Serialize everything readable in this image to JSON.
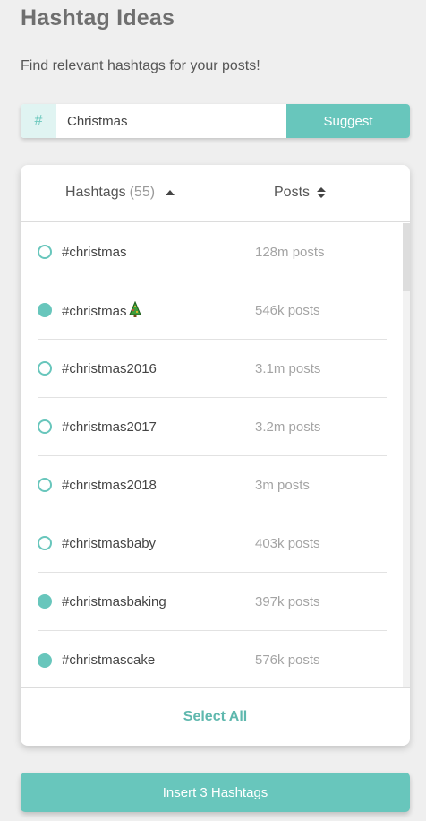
{
  "header": {
    "title": "Hashtag Ideas",
    "subtitle": "Find relevant hashtags for your posts!"
  },
  "search": {
    "prefix": "#",
    "value": "Christmas",
    "suggest_label": "Suggest"
  },
  "table": {
    "col_hashtags_label": "Hashtags",
    "col_hashtags_count": "(55)",
    "col_posts_label": "Posts",
    "rows": [
      {
        "tag": "#christmas",
        "posts": "128m posts",
        "selected": false,
        "emoji": ""
      },
      {
        "tag": "#christmas",
        "posts": "546k posts",
        "selected": true,
        "emoji": "tree-icon"
      },
      {
        "tag": "#christmas2016",
        "posts": "3.1m posts",
        "selected": false,
        "emoji": ""
      },
      {
        "tag": "#christmas2017",
        "posts": "3.2m posts",
        "selected": false,
        "emoji": ""
      },
      {
        "tag": "#christmas2018",
        "posts": "3m posts",
        "selected": false,
        "emoji": ""
      },
      {
        "tag": "#christmasbaby",
        "posts": "403k posts",
        "selected": false,
        "emoji": ""
      },
      {
        "tag": "#christmasbaking",
        "posts": "397k posts",
        "selected": true,
        "emoji": ""
      },
      {
        "tag": "#christmascake",
        "posts": "576k posts",
        "selected": true,
        "emoji": ""
      }
    ],
    "select_all_label": "Select All"
  },
  "footer": {
    "insert_label": "Insert 3 Hashtags"
  },
  "colors": {
    "accent": "#68c6bc",
    "accent_light": "#e0f4f2",
    "background": "#efefef"
  }
}
